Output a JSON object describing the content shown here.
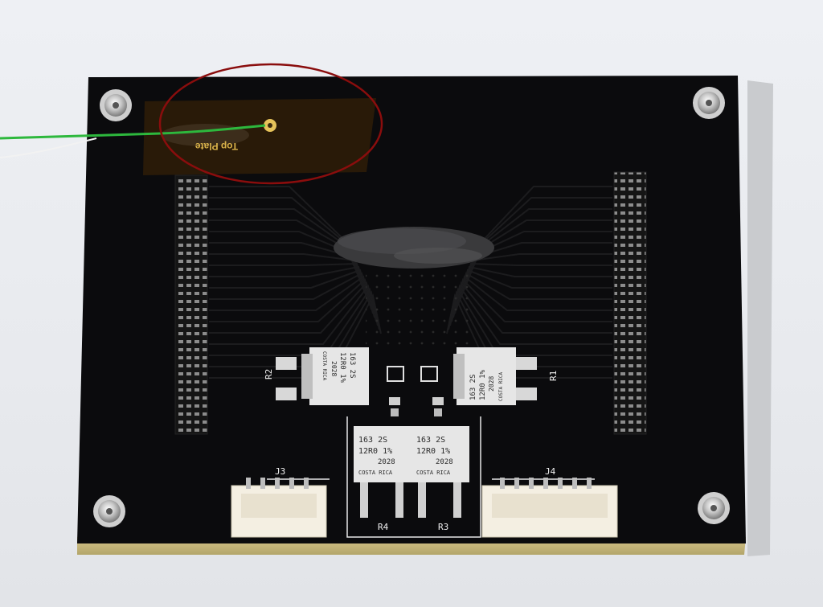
{
  "colors": {
    "background": "#e9ebef",
    "board": "#0b0b0d",
    "silkscreen": "#f2f2f2",
    "kapton": "#2b1b08",
    "wire_green": "#2db83d",
    "annotation_circle": "#8a0d0d",
    "resistor_body": "#e0e0e0",
    "connector": "#f4efe2"
  },
  "kapton_label": "Top Plate",
  "components": {
    "r1": "R1",
    "r2": "R2",
    "r3": "R3",
    "r4": "R4",
    "j3": "J3",
    "j4": "J4"
  },
  "resistor_marking": {
    "line1": "163 2S",
    "line2": "12R0 1%",
    "line3": "2028",
    "line4": "COSTA RICA"
  }
}
